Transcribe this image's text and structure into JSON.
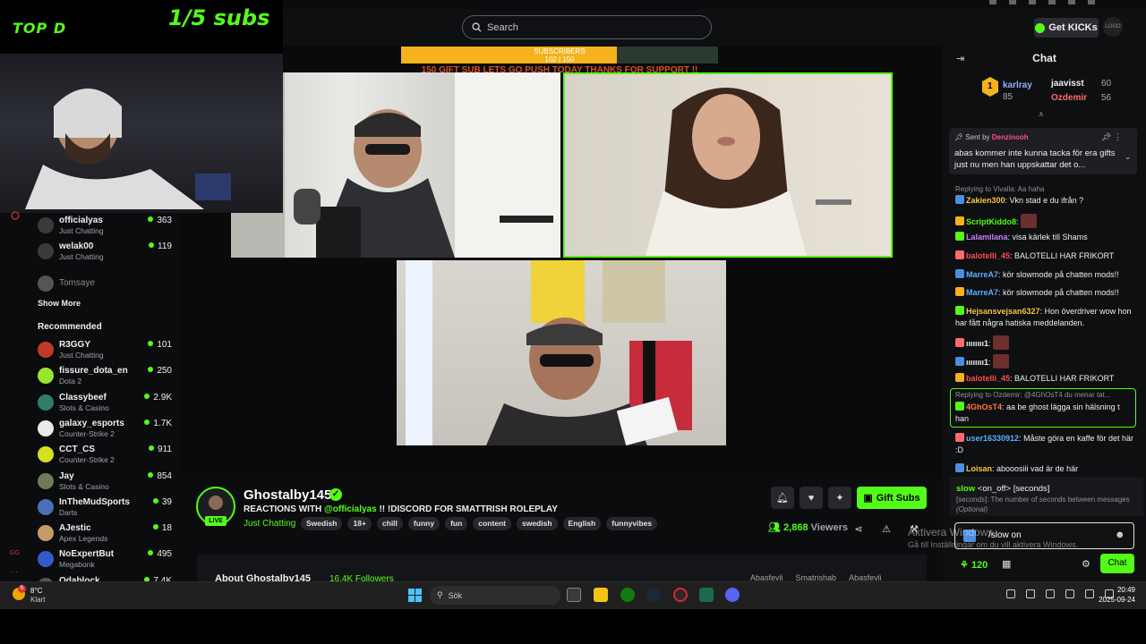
{
  "overlay": {
    "top_label": "TOP D",
    "goal_label": "1/5 subs"
  },
  "topbar": {
    "search_placeholder": "Search",
    "get_kicks": "Get KICKs",
    "avatar_text": "LOGO"
  },
  "video": {
    "subscribers_label": "SUBSCRIBERS",
    "subscribers_count": "102 | 150",
    "subscribers_progress": 0.68,
    "banner_text": "150 GIFT SUB LETS GO PUSH TODAY THANKS FOR SUPPORT !!"
  },
  "sidebar": {
    "following": [
      {
        "name": "officialyas",
        "category": "Just Chatting",
        "viewers": "363",
        "color": "#3a3a3a"
      },
      {
        "name": "welak00",
        "category": "Just Chatting",
        "viewers": "119",
        "color": "#3a3a3a"
      },
      {
        "name": "Tomsaye",
        "category": "",
        "viewers": "",
        "color": "#555"
      }
    ],
    "show_more": "Show More",
    "recommended_label": "Recommended",
    "recommended": [
      {
        "name": "R3GGY",
        "category": "Just Chatting",
        "viewers": "101",
        "color": "#c0392b"
      },
      {
        "name": "fissure_dota_en",
        "category": "Dota 2",
        "viewers": "250",
        "color": "#9ae62e"
      },
      {
        "name": "Classybeef",
        "category": "Slots & Casino",
        "viewers": "2.9K",
        "color": "#2f7d6d"
      },
      {
        "name": "galaxy_esports",
        "category": "Counter-Strike 2",
        "viewers": "1.7K",
        "color": "#eaeaea"
      },
      {
        "name": "CCT_CS",
        "category": "Counter-Strike 2",
        "viewers": "911",
        "color": "#d6e01c"
      },
      {
        "name": "Jay",
        "category": "Slots & Casino",
        "viewers": "854",
        "color": "#6b7c56"
      },
      {
        "name": "InTheMudSports",
        "category": "Darts",
        "viewers": "39",
        "color": "#4a6fb5"
      },
      {
        "name": "AJestic",
        "category": "Apex Legends",
        "viewers": "18",
        "color": "#c89a6a"
      },
      {
        "name": "NoExpertBut",
        "category": "Megabonk",
        "viewers": "495",
        "color": "#3559c7"
      },
      {
        "name": "Odablock",
        "category": "",
        "viewers": "7.4K",
        "color": "#555"
      }
    ]
  },
  "stream": {
    "name": "Ghostalby145",
    "live": "LIVE",
    "title_prefix": "REACTIONS WITH ",
    "title_mention": "@officialyas",
    "title_suffix": " !! !DISCORD FOR SMATTRISH ROLEPLAY",
    "category": "Just Chatting",
    "tags": [
      "Swedish",
      "18+",
      "chill",
      "funny",
      "fun",
      "content",
      "swedish",
      "English",
      "funnyvibes"
    ],
    "viewers_count": "2,868",
    "viewers_label": "Viewers",
    "gift_subs": "Gift Subs",
    "about_label": "About Ghostalby145",
    "followers": "16.4K Followers",
    "socials": [
      "Abasfevli",
      "Smatrishab",
      "Abasfevli"
    ]
  },
  "chat": {
    "title": "Chat",
    "leaderboard": [
      {
        "rank": "1",
        "name": "karlray",
        "points": "85"
      },
      {
        "name": "jaavisst",
        "points": "60"
      },
      {
        "name": "Ozdemir",
        "points": "56"
      }
    ],
    "pinned_sent_by_label": "Sent by",
    "pinned_by": "Denzinooh",
    "pinned_message": "abas kommer inte kunna tacka för era gifts just nu men han uppskattar det o...",
    "messages": [
      {
        "reply": "Replying to Vivalla: Aa haha",
        "user": "Zakien300",
        "color": "#f5c542",
        "text": "Vkn stad e du ifrån ?"
      },
      {
        "user": "ScriptKiddo8",
        "color": "#53fc18",
        "text": ""
      },
      {
        "user": "Lalamilana",
        "color": "#c77dff",
        "text": "visa kärlek till Shams"
      },
      {
        "user": "balotelli_45",
        "color": "#ff4d4d",
        "text": "BALOTELLI HAR FRIKORT"
      },
      {
        "user": "MarreA7",
        "color": "#5ab0ff",
        "text": "kör slowmode på chatten mods!!"
      },
      {
        "user": "MarreA7",
        "color": "#5ab0ff",
        "text": "kör slowmode på chatten mods!!"
      },
      {
        "user": "Hejsansvejsan6327",
        "color": "#f5c542",
        "text": "Hon överdriver wow hon har fått några hatiska meddelanden."
      },
      {
        "user": "ıııııııı1",
        "color": "#efeff1",
        "text": ""
      },
      {
        "user": "ıııııııı1",
        "color": "#efeff1",
        "text": ""
      },
      {
        "user": "balotelli_45",
        "color": "#ff4d4d",
        "text": "BALOTELLI HAR FRIKORT"
      },
      {
        "reply": "Replying to Ozdemir: @4GhOsT4 du menar tat...",
        "user": "4GhOsT4",
        "color": "#ff7a45",
        "text": "aa be ghost lägga sin hälsning t han"
      },
      {
        "user": "user16330912",
        "color": "#5ab0ff",
        "text": "Måste göra en kaffe för det här :D"
      },
      {
        "user": "Loisan",
        "color": "#f5c542",
        "text": "abooosiii vad är de här"
      }
    ],
    "slow_cmd": "slow",
    "slow_args": "<on_off> [seconds]",
    "slow_desc": "[seconds]: The number of seconds between messages",
    "slow_optional": "(Optional)",
    "input_value": "/slow on",
    "points": "120",
    "send_label": "Chat"
  },
  "windows": {
    "activate_title": "Aktivera Windows",
    "activate_desc": "Gå till Inställningar om du vill aktivera Windows."
  },
  "taskbar": {
    "weather_temp": "8°C",
    "weather_cond": "Klart",
    "weather_badge": "5",
    "search_label": "Sök",
    "time": "20:49",
    "date": "2025-09-24"
  }
}
